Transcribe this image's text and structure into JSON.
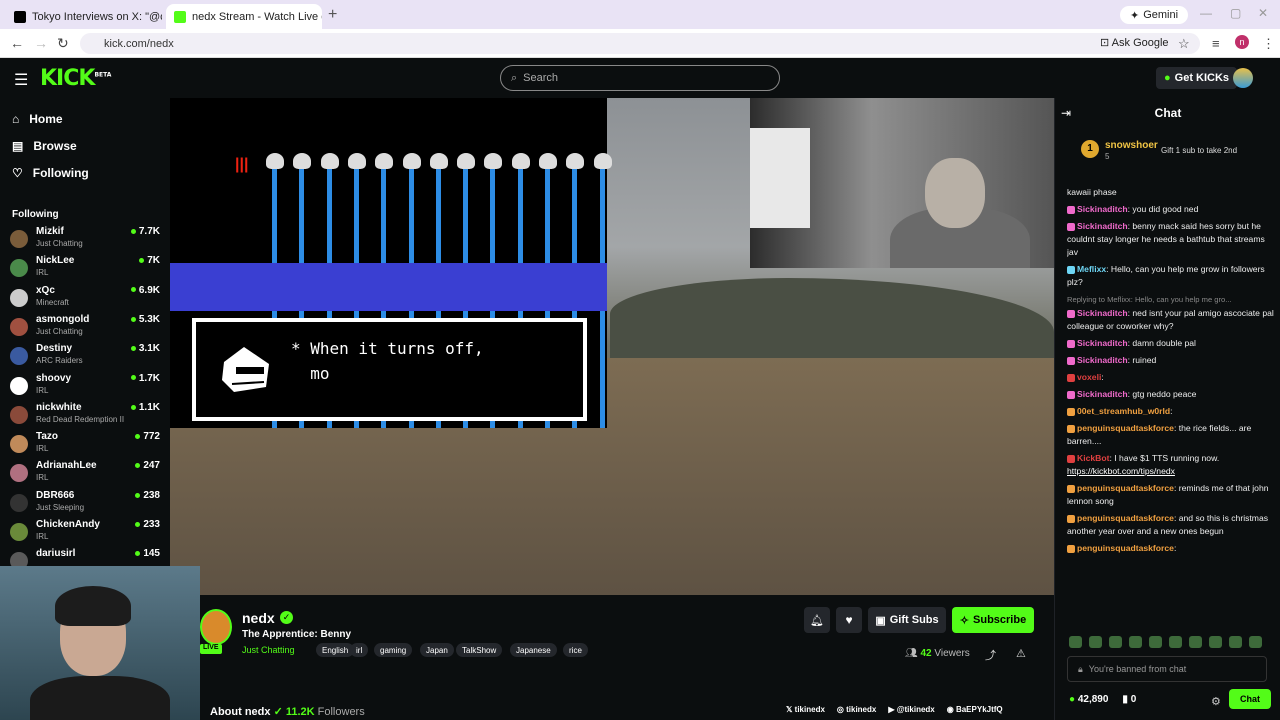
{
  "browser": {
    "tabs": [
      {
        "title": "Tokyo Interviews on X: \"@calli",
        "favicon_color": "#000000"
      },
      {
        "title": "nedx Stream - Watch Live o",
        "favicon_color": "#53fc18"
      }
    ],
    "new_tab": "+",
    "gemini": "Gemini",
    "url": "kick.com/nedx",
    "ask_google": "Ask Google",
    "profile_initial": "n"
  },
  "header": {
    "logo": "KICK",
    "logo_badge": "BETA",
    "search_placeholder": "Search",
    "get_kicks": "Get KICKs"
  },
  "sidebar": {
    "nav": [
      {
        "label": "Home",
        "icon": "home-icon"
      },
      {
        "label": "Browse",
        "icon": "browse-icon"
      },
      {
        "label": "Following",
        "icon": "heart-icon"
      }
    ],
    "following_heading": "Following",
    "following": [
      {
        "name": "Mizkif",
        "category": "Just Chatting",
        "viewers": "7.7K",
        "color": "#7a5c3a"
      },
      {
        "name": "NickLee",
        "category": "IRL",
        "viewers": "7K",
        "color": "#4a8a4a"
      },
      {
        "name": "xQc",
        "category": "Minecraft",
        "viewers": "6.9K",
        "color": "#cccccc"
      },
      {
        "name": "asmongold",
        "category": "Just Chatting",
        "viewers": "5.3K",
        "color": "#a05040"
      },
      {
        "name": "Destiny",
        "category": "ARC Raiders",
        "viewers": "3.1K",
        "color": "#3a5aa0"
      },
      {
        "name": "shoovy",
        "category": "IRL",
        "viewers": "1.7K",
        "color": "#ffffff"
      },
      {
        "name": "nickwhite",
        "category": "Red Dead Redemption II",
        "viewers": "1.1K",
        "color": "#8a4a3a"
      },
      {
        "name": "Tazo",
        "category": "IRL",
        "viewers": "772",
        "color": "#c08a5a"
      },
      {
        "name": "AdrianahLee",
        "category": "IRL",
        "viewers": "247",
        "color": "#b07080"
      },
      {
        "name": "DBR666",
        "category": "Just Sleeping",
        "viewers": "238",
        "color": "#333333"
      },
      {
        "name": "ChickenAndy",
        "category": "IRL",
        "viewers": "233",
        "color": "#6a8a3a"
      },
      {
        "name": "dariusirl",
        "category": "",
        "viewers": "145",
        "color": "#5a5a5a"
      }
    ]
  },
  "video": {
    "dialog_text": "* When it turns off,\n  mo"
  },
  "channel": {
    "name": "nedx",
    "live": "LIVE",
    "title": "The Apprentice: Benny",
    "category": "Just Chatting",
    "tags": [
      "English",
      "irl",
      "gaming",
      "Japan",
      "TalkShow",
      "Japanese",
      "rice"
    ],
    "gift_subs": "Gift Subs",
    "subscribe": "Subscribe",
    "viewers": "42",
    "viewers_label": "Viewers",
    "about": "About nedx",
    "followers": "11.2K",
    "followers_label": "Followers",
    "socials": [
      "tikinedx",
      "tikinedx",
      "@tikinedx",
      "BaEPYkJtfQ"
    ]
  },
  "chat": {
    "title": "Chat",
    "pinned": {
      "rank": "1",
      "name": "snowshoer",
      "count": "5",
      "gift_text": "Gift 1 sub to take 2nd"
    },
    "messages": [
      {
        "user": "",
        "text": "kawaii phase",
        "color": "#ffffff"
      },
      {
        "user": "Sickinaditch",
        "text": "you did good ned",
        "color": "#f06acb"
      },
      {
        "user": "Sickinaditch",
        "text": "benny mack said hes sorry but he couldnt stay longer he needs a bathtub that streams jav",
        "color": "#f06acb"
      },
      {
        "user": "Meflixx",
        "text": "Hello, can you help me grow in followers plz?",
        "color": "#6ed6f5"
      },
      {
        "reply": "Replying to Meflixx: Hello, can you help me gro..."
      },
      {
        "user": "Sickinaditch",
        "text": "ned isnt your pal amigo ascociate pal colleague or coworker why?",
        "color": "#f06acb"
      },
      {
        "user": "Sickinaditch",
        "text": "damn double pal",
        "color": "#f06acb"
      },
      {
        "user": "Sickinaditch",
        "text": "ruined",
        "color": "#f06acb"
      },
      {
        "user": "voxeli",
        "text": "",
        "color": "#e04040"
      },
      {
        "user": "Sickinaditch",
        "text": "gtg neddo peace",
        "color": "#f06acb"
      },
      {
        "user": "00et_streamhub_w0rld",
        "text": "",
        "color": "#f0a040"
      },
      {
        "user": "penguinsquadtaskforce",
        "text": "the rice fields... are barren....",
        "color": "#f0a040"
      },
      {
        "user": "KickBot",
        "text": "I have $1 TTS running now.",
        "color": "#e04040",
        "link": "https://kickbot.com/tips/nedx"
      },
      {
        "user": "penguinsquadtaskforce",
        "text": "reminds me of that john lennon song",
        "color": "#f0a040"
      },
      {
        "user": "penguinsquadtaskforce",
        "text": "and so this is christmas another year over and a new ones begun",
        "color": "#f0a040"
      },
      {
        "user": "penguinsquadtaskforce",
        "text": "",
        "color": "#f0a040"
      }
    ],
    "banned_text": "You're banned from chat",
    "kicks": "42,890",
    "points": "0",
    "send": "Chat"
  }
}
